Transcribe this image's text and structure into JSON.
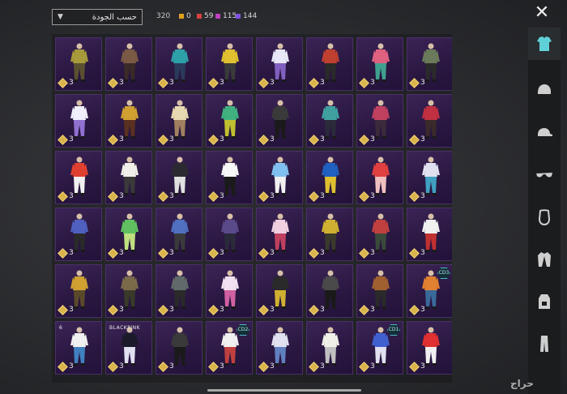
{
  "header": {
    "sort_label": "حسب الجودة",
    "total": "320",
    "rarities": [
      {
        "value": "0",
        "color": "#e0a020"
      },
      {
        "value": "59",
        "color": "#d84040"
      },
      {
        "value": "115",
        "color": "#c040c0"
      },
      {
        "value": "144",
        "color": "#8050e0"
      }
    ]
  },
  "sidebar": {
    "tabs": [
      {
        "icon": "outfit-icon",
        "active": true
      },
      {
        "icon": "helmet-icon"
      },
      {
        "icon": "cap-icon"
      },
      {
        "icon": "sunglasses-icon"
      },
      {
        "icon": "mask-icon"
      },
      {
        "icon": "jacket-icon"
      },
      {
        "icon": "backpack-icon"
      },
      {
        "icon": "pants-icon"
      }
    ]
  },
  "items": [
    {
      "qty": "3",
      "colors": [
        "#a79a3a",
        "#5a5030"
      ]
    },
    {
      "qty": "3",
      "colors": [
        "#7a5a44",
        "#3a2a28"
      ]
    },
    {
      "qty": "3",
      "colors": [
        "#2ea0a8",
        "#2a3a5a"
      ]
    },
    {
      "qty": "3",
      "colors": [
        "#e0c030",
        "#3a3a3a"
      ]
    },
    {
      "qty": "3",
      "colors": [
        "#e8e8f8",
        "#8060c0"
      ]
    },
    {
      "qty": "3",
      "colors": [
        "#c04030",
        "#2a2a2a"
      ]
    },
    {
      "qty": "3",
      "colors": [
        "#e06080",
        "#40a090"
      ]
    },
    {
      "qty": "3",
      "colors": [
        "#6a7a5a",
        "#2a2a2a"
      ]
    },
    {
      "qty": "3",
      "colors": [
        "#f0f0ff",
        "#9070d0"
      ]
    },
    {
      "qty": "3",
      "colors": [
        "#d0a030",
        "#5a3020"
      ]
    },
    {
      "qty": "3",
      "colors": [
        "#e8d8b0",
        "#a08060"
      ]
    },
    {
      "qty": "3",
      "colors": [
        "#40b080",
        "#c0c030"
      ]
    },
    {
      "qty": "3",
      "colors": [
        "#3a3a3a",
        "#1a1a1a"
      ]
    },
    {
      "qty": "3",
      "colors": [
        "#40a0a0",
        "#2a2a3a"
      ]
    },
    {
      "qty": "3",
      "colors": [
        "#c04060",
        "#3a2a3a"
      ]
    },
    {
      "qty": "3",
      "colors": [
        "#c03040",
        "#3a2a2a"
      ]
    },
    {
      "qty": "3",
      "colors": [
        "#e04030",
        "#f0f0f0"
      ]
    },
    {
      "qty": "3",
      "colors": [
        "#f0f0e8",
        "#3a3a3a"
      ]
    },
    {
      "qty": "3",
      "colors": [
        "#2a2a30",
        "#e0e0e0"
      ]
    },
    {
      "qty": "3",
      "colors": [
        "#f8f8f8",
        "#1a1a1a"
      ]
    },
    {
      "qty": "3",
      "colors": [
        "#80c0f0",
        "#f0f0f0"
      ]
    },
    {
      "qty": "3",
      "colors": [
        "#2060c0",
        "#e0c030"
      ]
    },
    {
      "qty": "3",
      "colors": [
        "#e04040",
        "#f0c0c0"
      ]
    },
    {
      "qty": "3",
      "colors": [
        "#e0e0f0",
        "#40a0c0"
      ]
    },
    {
      "qty": "3",
      "colors": [
        "#5060c0",
        "#2a2a2a"
      ]
    },
    {
      "qty": "3",
      "colors": [
        "#60c060",
        "#c0e080"
      ]
    },
    {
      "qty": "3",
      "colors": [
        "#5070c0",
        "#3a3a3a"
      ]
    },
    {
      "qty": "3",
      "colors": [
        "#5a4a8a",
        "#2a2a3a"
      ]
    },
    {
      "qty": "3",
      "colors": [
        "#f0d0e0",
        "#c04060"
      ]
    },
    {
      "qty": "3",
      "colors": [
        "#d0b030",
        "#3a3a2a"
      ]
    },
    {
      "qty": "3",
      "colors": [
        "#c04040",
        "#3a4a3a"
      ]
    },
    {
      "qty": "3",
      "colors": [
        "#f0f0f0",
        "#c03030"
      ]
    },
    {
      "qty": "3",
      "colors": [
        "#d0a030",
        "#5a4a2a"
      ]
    },
    {
      "qty": "3",
      "colors": [
        "#7a6a4a",
        "#3a3a2a"
      ]
    },
    {
      "qty": "3",
      "colors": [
        "#606a6a",
        "#2a2a2a"
      ]
    },
    {
      "qty": "3",
      "colors": [
        "#f0e0f0",
        "#d060a0"
      ]
    },
    {
      "qty": "3",
      "colors": [
        "#2a2a2a",
        "#d0b030"
      ]
    },
    {
      "qty": "3",
      "colors": [
        "#4a4a4a",
        "#1a1a1a"
      ]
    },
    {
      "qty": "3",
      "colors": [
        "#a06030",
        "#2a2a2a"
      ]
    },
    {
      "qty": "3",
      "colors": [
        "#e08030",
        "#3a6a9a"
      ],
      "badge": "CD3"
    },
    {
      "qty": "3",
      "colors": [
        "#f0f0f0",
        "#4080c0"
      ],
      "text": "6"
    },
    {
      "qty": "3",
      "colors": [
        "#1a1a2a",
        "#e0e0f0"
      ],
      "text": "BLACKPINK"
    },
    {
      "qty": "3",
      "colors": [
        "#3a3a3a",
        "#1a1a1a"
      ]
    },
    {
      "qty": "3",
      "colors": [
        "#f0f0f0",
        "#c04040"
      ],
      "badge": "CD2"
    },
    {
      "qty": "3",
      "colors": [
        "#e0e0f0",
        "#6080c0"
      ]
    },
    {
      "qty": "3",
      "colors": [
        "#f0f0e8",
        "#c0c0c0"
      ]
    },
    {
      "qty": "3",
      "colors": [
        "#4060d0",
        "#e0e0f0"
      ],
      "badge": "CD1"
    },
    {
      "qty": "3",
      "colors": [
        "#e03030",
        "#f0f0f0"
      ]
    }
  ],
  "watermark": "حراج"
}
